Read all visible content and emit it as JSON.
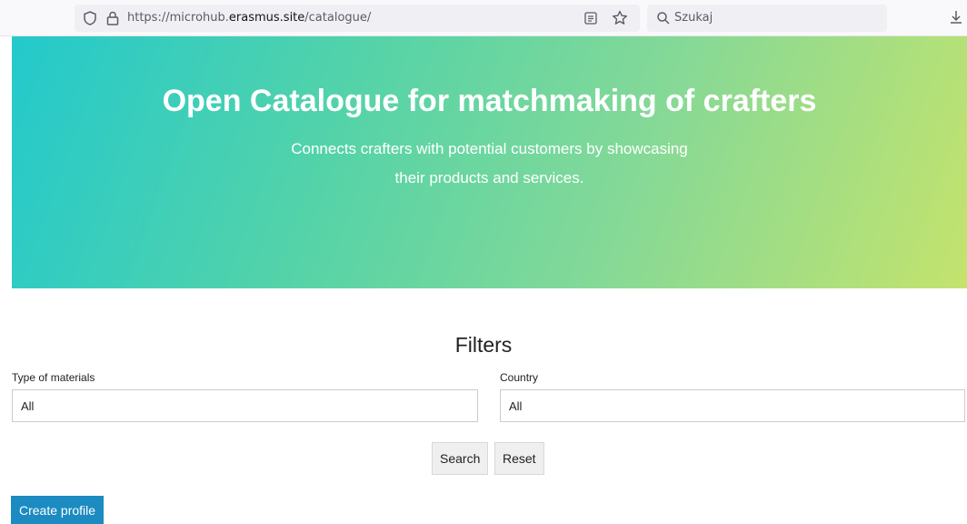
{
  "browser": {
    "url_prefix": "https://microhub.",
    "url_host": "erasmus.site",
    "url_path": "/catalogue/",
    "search_placeholder": "Szukaj"
  },
  "hero": {
    "title": "Open Catalogue for matchmaking of crafters",
    "subtitle_line1": "Connects crafters with potential customers by showcasing",
    "subtitle_line2": "their products and services."
  },
  "filters": {
    "title": "Filters",
    "materials_label": "Type of materials",
    "materials_value": "All",
    "country_label": "Country",
    "country_value": "All",
    "search_button": "Search",
    "reset_button": "Reset"
  },
  "actions": {
    "create_profile": "Create profile"
  },
  "colors": {
    "gradient_start": "#23c9cc",
    "gradient_end": "#c4e36d",
    "primary_button": "#1b8bc2"
  }
}
